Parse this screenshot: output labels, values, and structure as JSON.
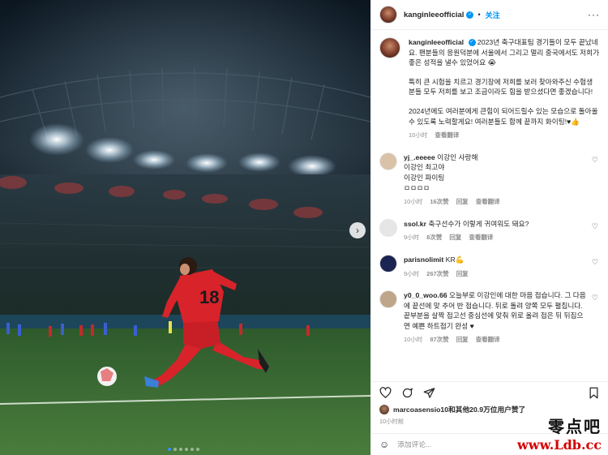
{
  "post": {
    "carousel": {
      "slide_count": 6,
      "active_slide": 1
    },
    "player_number": "18"
  },
  "header": {
    "username": "kanginleeofficial",
    "follow_label": "关注",
    "more_label": "···"
  },
  "caption": {
    "username": "kanginleeofficial",
    "paragraphs": [
      "2023년 축구대표팀 경기들이 모두 끝났네요. 팬분들의 응원덕분에 서울에서 그리고 멀리 중국에서도 저희가 좋은 성적을 낼수 있었어요 😭",
      "특히 큰 시험을 치르고 경기장에 저희를 보러 찾아와주신 수험생 분들 모두 저희를 보고 조금이라도 힘을 받으셨다면 좋겠습니다!",
      "2024년에도 여러분에게 큰힘이 되어드릴수 있는 모습으로 돌아올수 있도록 노력할게요! 여러분들도 함께 끝까지 화이팅!♥👍"
    ],
    "time": "10小时",
    "translate_label": "查看翻译"
  },
  "comments": [
    {
      "username": "yj_.eeeee",
      "lines": [
        "이강인 사랑해",
        "이강인 최고야",
        "이강인 파이팅",
        "ㅁㅁㅁㅁ"
      ],
      "time": "10小时",
      "likes": "16次赞",
      "reply_label": "回复",
      "translate_label": "查看翻译",
      "avatar_color": "#d9c2a8"
    },
    {
      "username": "ssol.kr",
      "lines": [
        "축구선수가 이렇게 귀여워도 돼요?"
      ],
      "time": "9小时",
      "likes": "8次赞",
      "reply_label": "回复",
      "translate_label": "查看翻译",
      "avatar_color": "#e6e6e6"
    },
    {
      "username": "parisnolimit",
      "lines": [
        "KR💪"
      ],
      "time": "9小时",
      "likes": "267次赞",
      "reply_label": "回复",
      "translate_label": "",
      "avatar_color": "#1c2452"
    },
    {
      "username": "y0_0_woo.66",
      "lines": [
        "오늘부로 이강인에 대한 마음 접습니다. 그 다음에 끝선에 맞 추어 반 접습니다. 뒤로 돌려 양쪽 모두 펼칩니다. 끝부분을 살짝 접고선 중심선에 맞춰 위로 올려 접은 뒤 뒤집으면 예쁜 하트접기 완성 ♥"
      ],
      "time": "10小时",
      "likes": "87次赞",
      "reply_label": "回复",
      "translate_label": "查看翻译",
      "avatar_color": "#bfa58a"
    }
  ],
  "likes": {
    "liker": "marcoasensio10",
    "text": "和其他20.9万位用户赞了"
  },
  "post_time": "10小时前",
  "add_comment": {
    "placeholder": "添加评论..."
  },
  "watermark": {
    "cn": "零点吧",
    "url": "www.Ldb.cc"
  },
  "colors": {
    "accent": "#0095f6",
    "pitch": "#2f6b2b",
    "jersey": "#d8232a"
  }
}
